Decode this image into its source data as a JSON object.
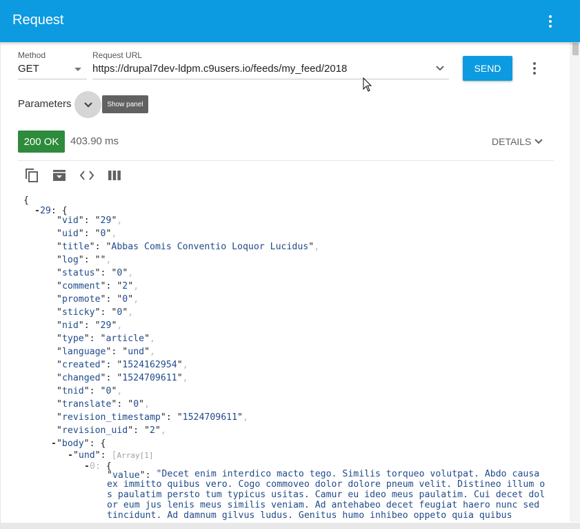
{
  "app": {
    "title": "Request",
    "menu_icon": "more-vert-icon"
  },
  "request": {
    "method_label": "Method",
    "method_value": "GET",
    "url_label": "Request URL",
    "url_value": "https://drupal7dev-ldpm.c9users.io/feeds/my_feed/2018",
    "send_label": "SEND"
  },
  "parameters": {
    "label": "Parameters",
    "tooltip": "Show panel"
  },
  "response": {
    "status": "200 OK",
    "status_color": "#2e8b3c",
    "time": "403.90 ms",
    "details_label": "DETAILS"
  },
  "toolbar": {
    "icons": [
      "copy-icon",
      "archive-icon",
      "code-icon",
      "columns-icon"
    ]
  },
  "json": {
    "open_brace": "{",
    "top_key": "29",
    "fields": [
      {
        "key": "vid",
        "value": "29"
      },
      {
        "key": "uid",
        "value": "0"
      },
      {
        "key": "title",
        "value": "Abbas Comis Conventio Loquor Lucidus"
      },
      {
        "key": "log",
        "value": ""
      },
      {
        "key": "status",
        "value": "0"
      },
      {
        "key": "comment",
        "value": "2"
      },
      {
        "key": "promote",
        "value": "0"
      },
      {
        "key": "sticky",
        "value": "0"
      },
      {
        "key": "nid",
        "value": "29"
      },
      {
        "key": "type",
        "value": "article"
      },
      {
        "key": "language",
        "value": "und"
      },
      {
        "key": "created",
        "value": "1524162954"
      },
      {
        "key": "changed",
        "value": "1524709611"
      },
      {
        "key": "tnid",
        "value": "0"
      },
      {
        "key": "translate",
        "value": "0"
      },
      {
        "key": "revision_timestamp",
        "value": "1524709611"
      },
      {
        "key": "revision_uid",
        "value": "2"
      }
    ],
    "body_key": "body",
    "und_key": "und",
    "und_hint": "Array[1]",
    "index_key": "0",
    "value_key": "value",
    "value_text": "\"Decet enim interdico macto tego. Similis torqueo volutpat. Abdo causa ex immitto quibus vero. Cogo commoveo dolor dolore pneum velit. Distineo illum os paulatim persto tum typicus usitas. Camur eu ideo meus paulatim. Cui decet dolor eum jus lenis meus similis veniam. Ad antehabeo decet feugiat haero nunc sed tincidunt. Ad damnum gilvus ludus. Genitus humo inhibeo oppeto quia quibus"
  }
}
